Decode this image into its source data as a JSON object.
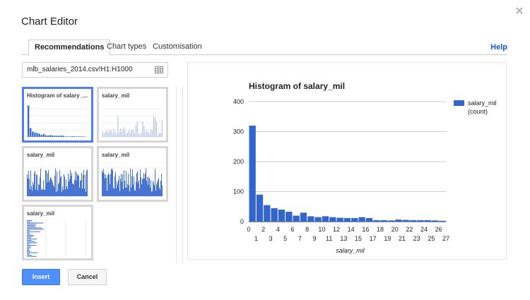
{
  "dialog": {
    "title": "Chart Editor"
  },
  "tabs": [
    {
      "label": "Recommendations",
      "active": true
    },
    {
      "label": "Chart types",
      "active": false
    },
    {
      "label": "Customisation",
      "active": false
    }
  ],
  "help_label": "Help",
  "data_range": "mlb_salaries_2014.csv!H1:H1000",
  "thumbnails": [
    {
      "label": "Histogram of salary_...",
      "kind": "histogram",
      "selected": true
    },
    {
      "label": "salary_mil",
      "kind": "column-sparse",
      "selected": false
    },
    {
      "label": "salary_mil",
      "kind": "column-dense",
      "selected": false
    },
    {
      "label": "salary_mil",
      "kind": "column-dense",
      "selected": false
    },
    {
      "label": "salary_mil",
      "kind": "bar-horizontal",
      "selected": false
    }
  ],
  "buttons": {
    "insert": "Insert",
    "cancel": "Cancel"
  },
  "colors": {
    "series": "#3366cc",
    "accent": "#4d90fe",
    "link": "#1155cc"
  },
  "chart_data": {
    "type": "bar",
    "title": "Histogram of salary_mil",
    "xlabel": "salary_mil",
    "ylabel": "",
    "legend": "salary_mil (count)",
    "legend_position": "right",
    "grid": true,
    "ylim": [
      0,
      400
    ],
    "yticks": [
      0,
      100,
      200,
      300,
      400
    ],
    "xlim": [
      0,
      27
    ],
    "xticks_top": [
      "0",
      "2",
      "4",
      "6",
      "8",
      "10",
      "12",
      "14",
      "16",
      "18",
      "20",
      "22",
      "24",
      "26"
    ],
    "xticks_bottom": [
      "1",
      "3",
      "5",
      "7",
      "9",
      "11",
      "13",
      "15",
      "17",
      "19",
      "21",
      "23",
      "25",
      "27"
    ],
    "bins_start": [
      0,
      1,
      2,
      3,
      4,
      5,
      6,
      7,
      8,
      9,
      10,
      11,
      12,
      13,
      14,
      15,
      16,
      17,
      18,
      19,
      20,
      21,
      22,
      23,
      24,
      25,
      26
    ],
    "values": [
      320,
      90,
      55,
      45,
      40,
      33,
      20,
      30,
      18,
      15,
      18,
      15,
      13,
      12,
      12,
      15,
      12,
      5,
      5,
      4,
      7,
      6,
      5,
      5,
      5,
      4,
      3
    ]
  }
}
